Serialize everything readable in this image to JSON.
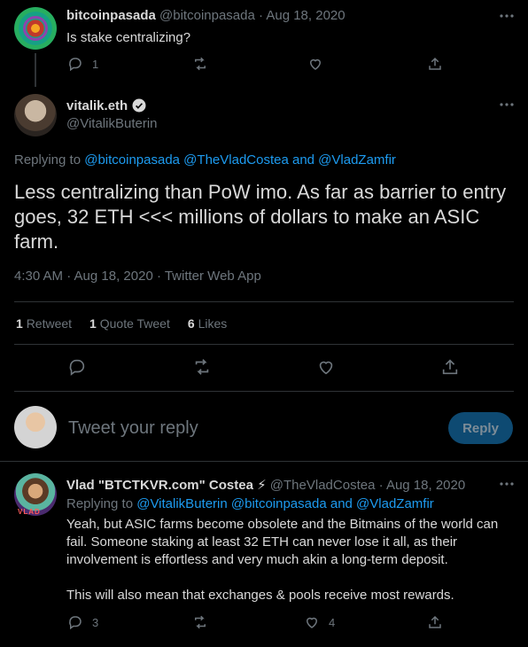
{
  "parent_tweet": {
    "display_name": "bitcoinpasada",
    "handle": "@bitcoinpasada",
    "date": "Aug 18, 2020",
    "text": "Is stake centralizing?",
    "reply_count": "1"
  },
  "main_tweet": {
    "display_name": "vitalik.eth",
    "handle": "@VitalikButerin",
    "replying_prefix": "Replying to",
    "replying_to": "@bitcoinpasada @TheVladCostea and @VladZamfir",
    "text": "Less centralizing than PoW imo. As far as barrier to entry goes, 32 ETH <<< millions of dollars to make an ASIC farm.",
    "timestamp": "4:30 AM · Aug 18, 2020 · Twitter Web App",
    "stats": [
      {
        "count": "1",
        "label": "Retweet"
      },
      {
        "count": "1",
        "label": "Quote Tweet"
      },
      {
        "count": "6",
        "label": "Likes"
      }
    ]
  },
  "composer": {
    "placeholder": "Tweet your reply",
    "reply_label": "Reply"
  },
  "reply_tweet": {
    "display_name": "Vlad \"BTCTKVR.com\" Costea ⚡",
    "handle": "@TheVladCostea",
    "date": "Aug 18, 2020",
    "avatar_tag": "VLAD",
    "replying_prefix": "Replying to",
    "replying_to": "@VitalikButerin @bitcoinpasada and @VladZamfir",
    "paragraph_1": "Yeah, but ASIC farms become obsolete and the Bitmains of the world can fail. Someone staking at least 32 ETH can never lose it all, as their involvement is effortless and very much akin a long-term deposit.",
    "paragraph_2": "This will also mean that exchanges & pools receive most rewards.",
    "reply_count": "3",
    "like_count": "4"
  },
  "icons": {
    "more": "more-horizontal-icon",
    "reply": "reply-bubble-icon",
    "retweet": "retweet-icon",
    "like": "heart-icon",
    "share": "share-icon",
    "verified": "verified-badge-icon"
  },
  "colors": {
    "background": "#000000",
    "accent": "#1d9bf0",
    "muted": "#6e767d",
    "divider": "#2f3336",
    "reply_button_disabled": "#0e4a72"
  },
  "separator": " · "
}
